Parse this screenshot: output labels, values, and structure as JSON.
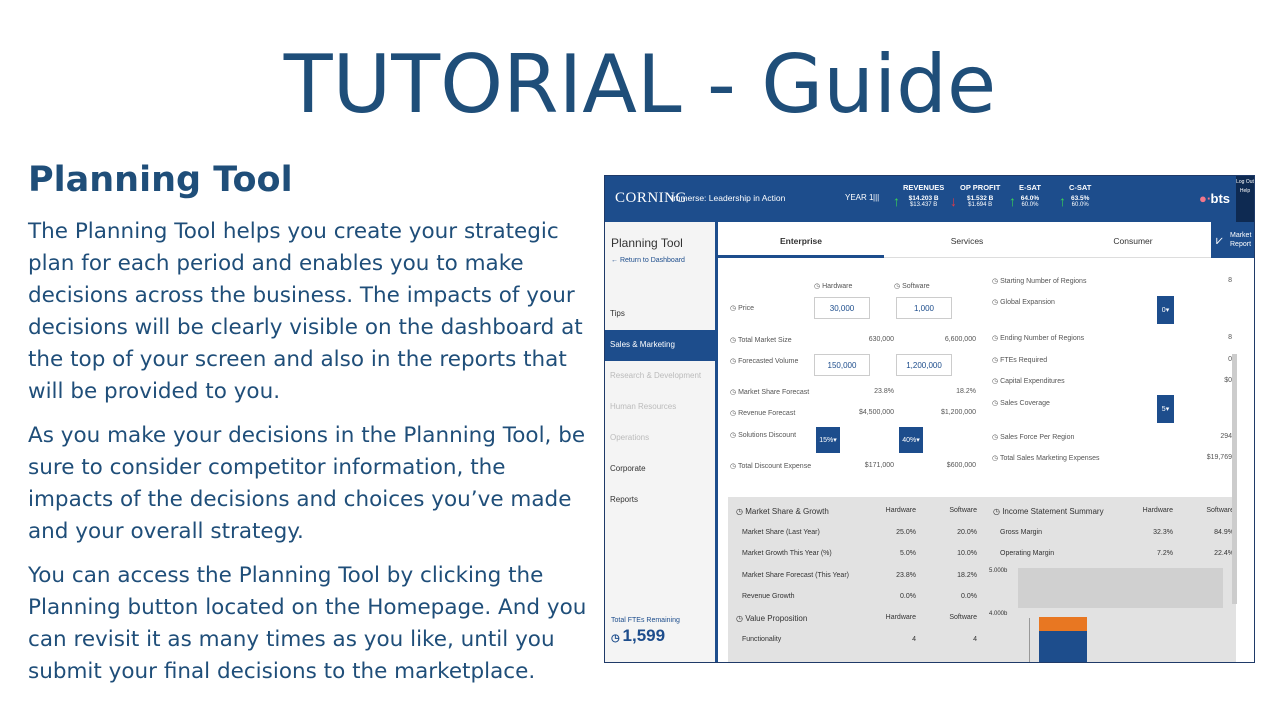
{
  "slide": {
    "title": "TUTORIAL - Guide",
    "section_title": "Planning Tool",
    "paragraphs": [
      "The Planning Tool helps you create your strategic plan for each period and enables you to make decisions across the business. The impacts of your decisions will be clearly visible on the dashboard at the top of your screen and also in the reports that will be provided to you.",
      "As you make your decisions in the Planning Tool, be sure to consider competitor information, the impacts of the decisions and choices you’ve made and your overall strategy.",
      "You can access the Planning Tool by clicking the Planning button located on the Homepage. And you can revisit it as many times as you like, until you submit your final decisions to the marketplace."
    ]
  },
  "app": {
    "brand": "CORNING",
    "subtitle": "Immerse: Leadership in Action",
    "year": "YEAR 1",
    "period_marker": "|||",
    "kpis": [
      {
        "title": "REVENUES",
        "value": "$14.203 B",
        "sub": "$13.437 B",
        "trend": "up"
      },
      {
        "title": "OP PROFIT",
        "value": "$1.532 B",
        "sub": "$1.694 B",
        "trend": "down"
      },
      {
        "title": "E-SAT",
        "value": "64.0%",
        "sub": "60.0%",
        "trend": "up"
      },
      {
        "title": "C-SAT",
        "value": "63.5%",
        "sub": "60.0%",
        "trend": "up"
      }
    ],
    "logo": "bts",
    "right_menu": {
      "logout": "Log Out",
      "help": "Help"
    },
    "sidebar": {
      "title": "Planning Tool",
      "back_link": "Return to Dashboard",
      "items": [
        "Tips",
        "Sales & Marketing",
        "Research & Development",
        "Human Resources",
        "Operations",
        "Corporate",
        "Reports"
      ],
      "fte_label": "Total FTEs Remaining",
      "fte_value": "1,599"
    },
    "tabs": [
      "Enterprise",
      "Services",
      "Consumer"
    ],
    "market_report": "Market Report",
    "form": {
      "col_hardware": "Hardware",
      "col_software": "Software",
      "price_label": "Price",
      "price_hw": "30,000",
      "price_sw": "1,000",
      "total_market_size_label": "Total Market Size",
      "total_market_size_hw": "630,000",
      "total_market_size_sw": "6,600,000",
      "forecasted_volume_label": "Forecasted Volume",
      "forecasted_volume_hw": "150,000",
      "forecasted_volume_sw": "1,200,000",
      "market_share_forecast_label": "Market Share Forecast",
      "market_share_forecast_hw": "23.8%",
      "market_share_forecast_sw": "18.2%",
      "revenue_forecast_label": "Revenue Forecast",
      "revenue_forecast_hw": "$4,500,000",
      "revenue_forecast_sw": "$1,200,000",
      "solutions_discount_label": "Solutions Discount",
      "solutions_discount_hw": "15%",
      "solutions_discount_sw": "40%",
      "total_discount_expense_label": "Total Discount Expense",
      "total_discount_expense_hw": "$171,000",
      "total_discount_expense_sw": "$600,000",
      "starting_regions_label": "Starting Number of Regions",
      "starting_regions_val": "8",
      "global_expansion_label": "Global Expansion",
      "global_expansion_val": "0",
      "ending_regions_label": "Ending Number of Regions",
      "ending_regions_val": "8",
      "ftes_required_label": "FTEs Required",
      "ftes_required_val": "0",
      "capex_label": "Capital Expenditures",
      "capex_val": "$0",
      "sales_coverage_label": "Sales Coverage",
      "sales_coverage_val": "5",
      "sales_force_label": "Sales Force Per Region",
      "sales_force_val": "294",
      "total_sales_mkt_label": "Total Sales Marketing Expenses",
      "total_sales_mkt_val": "$19,769"
    },
    "summary": {
      "msg_title": "Market Share & Growth",
      "hw": "Hardware",
      "sw": "Software",
      "rows": [
        {
          "label": "Market Share (Last Year)",
          "hw": "25.0%",
          "sw": "20.0%"
        },
        {
          "label": "Market Growth This Year (%)",
          "hw": "5.0%",
          "sw": "10.0%"
        },
        {
          "label": "Market Share Forecast (This Year)",
          "hw": "23.8%",
          "sw": "18.2%"
        },
        {
          "label": "Revenue Growth",
          "hw": "0.0%",
          "sw": "0.0%"
        }
      ],
      "vp_title": "Value Proposition",
      "vp_rows": [
        {
          "label": "Functionality",
          "hw": "4",
          "sw": "4"
        }
      ],
      "is_title": "Income Statement Summary",
      "is_rows": [
        {
          "label": "Gross Margin",
          "hw": "32.3%",
          "sw": "84.9%"
        },
        {
          "label": "Operating Margin",
          "hw": "7.2%",
          "sw": "22.4%"
        }
      ],
      "chart_y1": "5.000b",
      "chart_y2": "4.000b",
      "colors": {
        "bar_top": "#e87722",
        "bar_bottom": "#1d4d8c"
      }
    }
  }
}
